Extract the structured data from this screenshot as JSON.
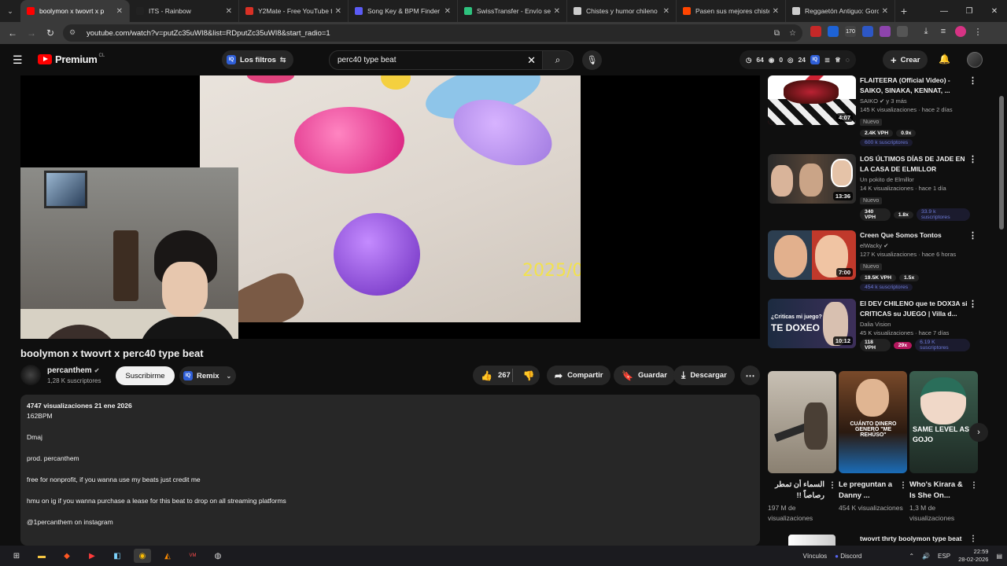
{
  "browser": {
    "tabs": [
      {
        "title": "boolymon x twovrt x p",
        "color": "#ff0000",
        "active": true
      },
      {
        "title": "ITS - Rainbow",
        "color": "#222222",
        "active": false
      },
      {
        "title": "Y2Mate - Free YouTube to",
        "color": "#d93025",
        "active": false
      },
      {
        "title": "Song Key & BPM Finder |",
        "color": "#5b5bf5",
        "active": false
      },
      {
        "title": "SwissTransfer - Envío seg",
        "color": "#2ec27e",
        "active": false
      },
      {
        "title": "Chistes y humor chileno",
        "color": "#cccccc",
        "active": false
      },
      {
        "title": "Pasen sus mejores chiste",
        "color": "#ff4500",
        "active": false
      },
      {
        "title": "Reggaetón Antiguo: Gorc",
        "color": "#cccccc",
        "active": false
      }
    ],
    "new_tab": "+",
    "url": "youtube.com/watch?v=putZc35uWI8&list=RDputZc35uWI8&start_radio=1"
  },
  "yt_header": {
    "brand": "Premium",
    "country": "CL",
    "filters_label": "Los filtros",
    "search_query": "perc40 type beat",
    "stats": {
      "a": "64",
      "b": "0",
      "c": "24"
    },
    "create_label": "Crear"
  },
  "video": {
    "watermark": "2025/0",
    "title": "boolymon x twovrt x perc40 type beat",
    "channel": "percanthem",
    "subscribers": "1,28 K suscriptores",
    "subscribe_label": "Suscribirme",
    "remix_label": "Remix",
    "likes": "267",
    "share_label": "Compartir",
    "save_label": "Guardar",
    "download_label": "Descargar"
  },
  "description": {
    "meta": "4747 visualizaciones  21 ene 2026",
    "lines": [
      "162BPM",
      "",
      "Dmaj",
      "",
      "prod. percanthem",
      "",
      "free for nonprofit, if you wanna use my beats just credit me",
      "",
      "hmu on ig if you wanna purchase a lease for this beat to drop on all streaming platforms",
      "",
      "@1percanthem on instagram"
    ]
  },
  "sidebar": [
    {
      "title": "FLAITEERA (Official Video) - SAIKO, SINAKA, KENNAT, ...",
      "channel": "SAIKO",
      "channel_suffix": "y 3 más",
      "meta": "145 K visualizaciones · hace 2 días",
      "badge": "Nuevo",
      "duration": "4:07",
      "vph": "2.4K VPH",
      "ratio": "0.9x",
      "subs": "600 k suscriptores",
      "ratio_red": false
    },
    {
      "title": "LOS ÚLTIMOS DÍAS DE JADE EN LA CASA DE ELMILLOR",
      "channel": "Un pokito de Elmillor",
      "channel_suffix": "",
      "meta": "14 K visualizaciones · hace 1 día",
      "badge": "Nuevo",
      "duration": "13:36",
      "vph": "340 VPH",
      "ratio": "1.8x",
      "subs": "33.9 k suscriptores",
      "ratio_red": false
    },
    {
      "title": "Creen Que Somos Tontos",
      "channel": "elWacky",
      "channel_suffix": "",
      "meta": "127 K visualizaciones · hace 6 horas",
      "badge": "Nuevo",
      "duration": "7:00",
      "vph": "19.5K VPH",
      "ratio": "1.5x",
      "subs": "454 k suscriptores",
      "ratio_red": false
    },
    {
      "title": "El DEV CHILENO que te DOX3A si CRITICAS su JUEGO | Villa d...",
      "channel": "Dalia Vision",
      "channel_suffix": "",
      "meta": "45 K visualizaciones · hace 7 días",
      "badge": "",
      "duration": "10:12",
      "vph": "118 VPH",
      "ratio": "29x",
      "subs": "6.19 K suscriptores",
      "ratio_red": true
    }
  ],
  "thumb_texts": {
    "thumb4_line1": "¿Criticas mi juego?",
    "thumb4_line2": "TE DOXEO",
    "short2_text": "CUÁNTO DINERO GENERÓ \"ME REHÚSO\"",
    "short3_text": "SAME LEVEL AS GOJO"
  },
  "shorts": [
    {
      "title": "السماء أن تمطر رصاصاً !!",
      "views": "197 M de visualizaciones"
    },
    {
      "title": "Le preguntan a Danny ...",
      "views": "454 K visualizaciones"
    },
    {
      "title": "Who's Kirara & Is She On...",
      "views": "1,3 M de visualizaciones"
    }
  ],
  "next_video": {
    "title": "twovrt thrty boolymon type beat"
  },
  "taskbar": {
    "links_label": "Vínculos",
    "discord_label": "Discord",
    "lang": "ESP",
    "time": "22:59",
    "date": "28-02-2026"
  }
}
